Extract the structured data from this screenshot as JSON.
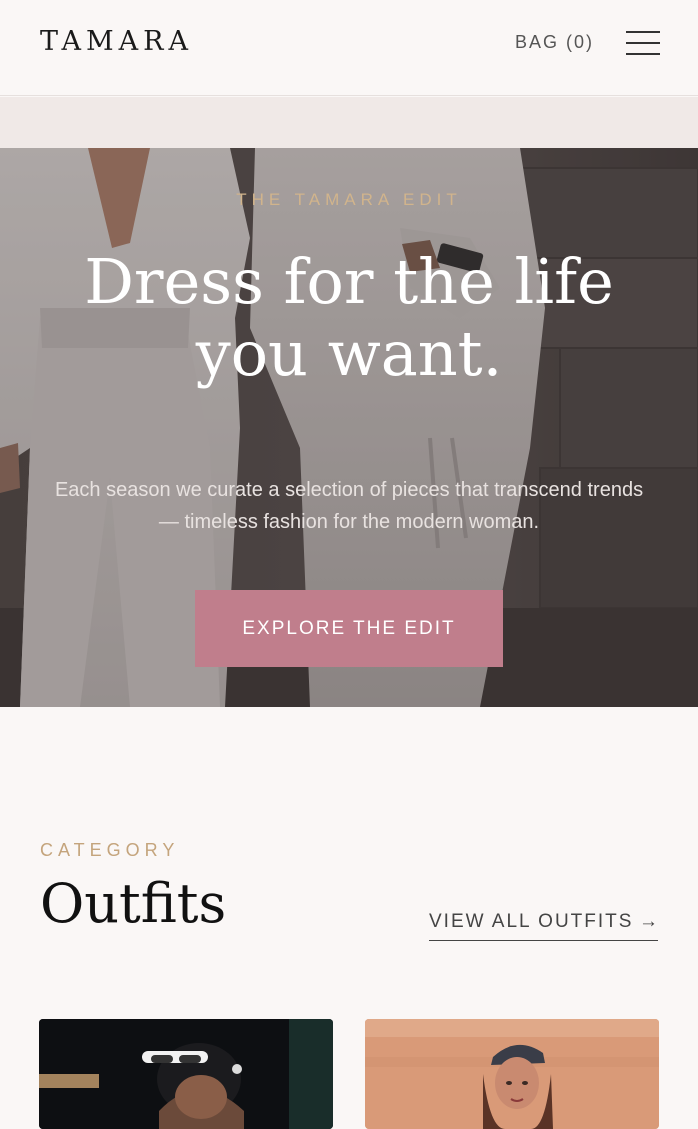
{
  "header": {
    "logo": "TAMARA",
    "bag_label": "BAG (0)",
    "menu_icon": "hamburger-menu-icon"
  },
  "hero": {
    "eyebrow": "THE TAMARA EDIT",
    "title": "Dress for the life you want.",
    "subtitle": "Each season we curate a selection of pieces that transcend trends — timeless fashion for the modern woman.",
    "cta_label": "EXPLORE THE EDIT",
    "cta_color": "#c07e8c",
    "eyebrow_color": "#d1b48c"
  },
  "category": {
    "eyebrow": "CATEGORY",
    "title": "Outfits",
    "view_all_label": "VIEW ALL OUTFITS",
    "view_all_arrow": "→",
    "accent_color": "#c4a47c"
  },
  "products": [
    {
      "image": "product-image-outfit-1"
    },
    {
      "image": "product-image-outfit-2"
    }
  ]
}
